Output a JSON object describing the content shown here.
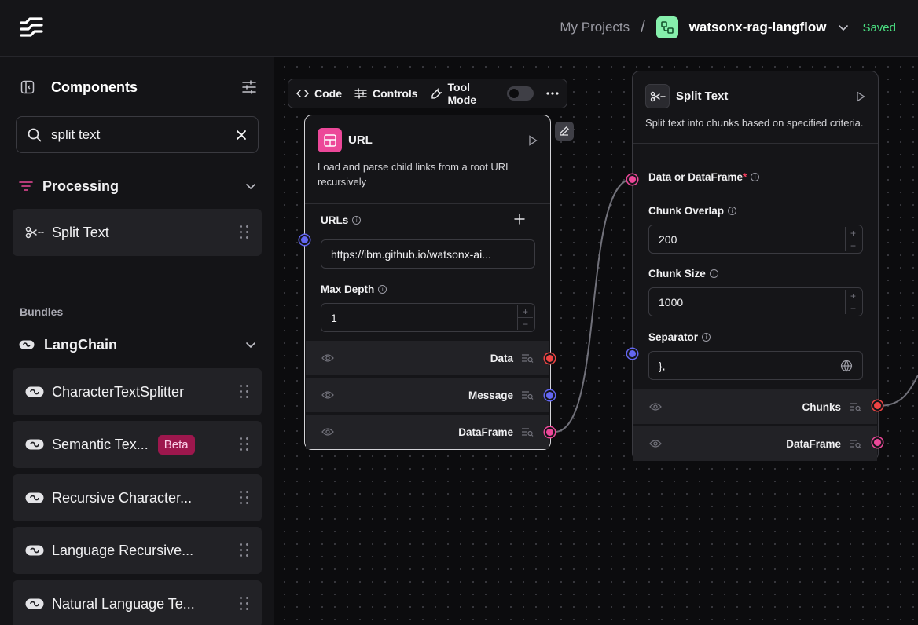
{
  "header": {
    "projects_label": "My Projects",
    "separator": "/",
    "project_name": "watsonx-rag-langflow",
    "save_status": "Saved"
  },
  "sidebar": {
    "title": "Components",
    "search": {
      "value": "split text"
    },
    "category": {
      "label": "Processing",
      "items": [
        {
          "label": "Split Text"
        }
      ]
    },
    "bundles_label": "Bundles",
    "bundle": {
      "label": "LangChain",
      "items": [
        {
          "label": "CharacterTextSplitter",
          "badge": ""
        },
        {
          "label": "Semantic Tex...",
          "badge": "Beta"
        },
        {
          "label": "Recursive Character...",
          "badge": ""
        },
        {
          "label": "Language Recursive...",
          "badge": ""
        },
        {
          "label": "Natural Language Te...",
          "badge": ""
        }
      ]
    }
  },
  "toolbar": {
    "code_label": "Code",
    "controls_label": "Controls",
    "tool_mode_label": "Tool Mode"
  },
  "url_node": {
    "title": "URL",
    "description": "Load and parse child links from a root URL recursively",
    "urls_label": "URLs",
    "url_value": "https://ibm.github.io/watsonx-ai...",
    "max_depth_label": "Max Depth",
    "max_depth_value": "1",
    "outputs": [
      "Data",
      "Message",
      "DataFrame"
    ]
  },
  "split_node": {
    "title": "Split Text",
    "description": "Split text into chunks based on specified criteria.",
    "input_label": "Data or DataFrame",
    "required_mark": "*",
    "chunk_overlap_label": "Chunk Overlap",
    "chunk_overlap_value": "200",
    "chunk_size_label": "Chunk Size",
    "chunk_size_value": "1000",
    "separator_label": "Separator",
    "separator_value": "},",
    "outputs": [
      "Chunks",
      "DataFrame"
    ]
  },
  "colors": {
    "accent_green": "#4ade80",
    "url_icon_bg": "#ec4899",
    "handle_red": "#ef4444",
    "handle_blue": "#6366f1",
    "handle_pink": "#ec4899",
    "beta_badge": "#9d174d"
  }
}
